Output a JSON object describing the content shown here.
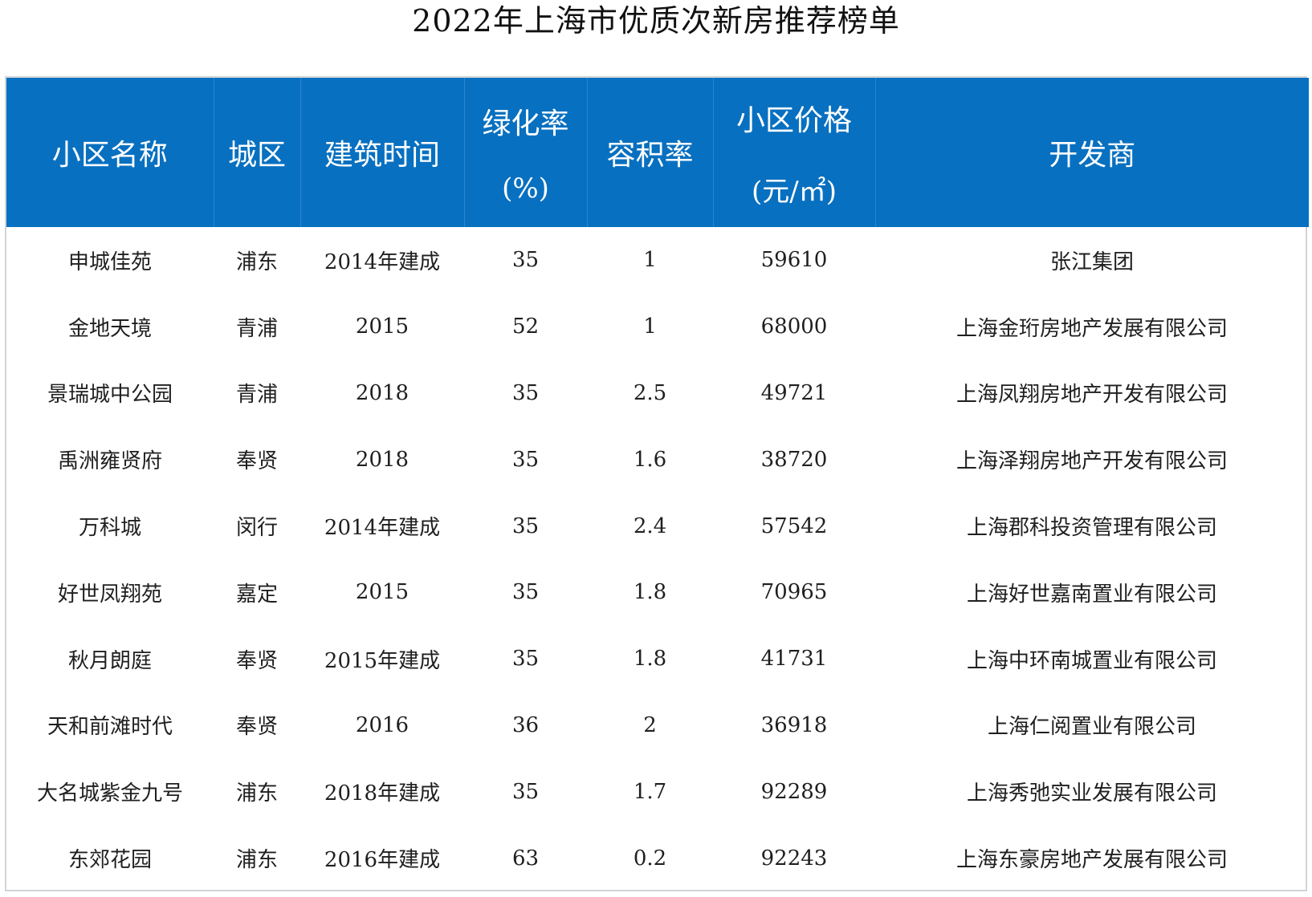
{
  "title": "2022年上海市优质次新房推荐榜单",
  "columns": {
    "name": "小区名称",
    "district": "城区",
    "built": "建筑时间",
    "green_rate": "绿化率",
    "green_rate_unit": "(%)",
    "plot_ratio": "容积率",
    "price": "小区价格",
    "price_unit": "(元/㎡)",
    "developer": "开发商"
  },
  "rows": [
    {
      "name": "申城佳苑",
      "district": "浦东",
      "built": "2014年建成",
      "green_rate": "35",
      "plot_ratio": "1",
      "price": "59610",
      "developer": "张江集团"
    },
    {
      "name": "金地天境",
      "district": "青浦",
      "built": "2015",
      "green_rate": "52",
      "plot_ratio": "1",
      "price": "68000",
      "developer": "上海金珩房地产发展有限公司"
    },
    {
      "name": "景瑞城中公园",
      "district": "青浦",
      "built": "2018",
      "green_rate": "35",
      "plot_ratio": "2.5",
      "price": "49721",
      "developer": "上海凤翔房地产开发有限公司"
    },
    {
      "name": "禹洲雍贤府",
      "district": "奉贤",
      "built": "2018",
      "green_rate": "35",
      "plot_ratio": "1.6",
      "price": "38720",
      "developer": "上海泽翔房地产开发有限公司"
    },
    {
      "name": "万科城",
      "district": "闵行",
      "built": "2014年建成",
      "green_rate": "35",
      "plot_ratio": "2.4",
      "price": "57542",
      "developer": "上海郡科投资管理有限公司"
    },
    {
      "name": "好世凤翔苑",
      "district": "嘉定",
      "built": "2015",
      "green_rate": "35",
      "plot_ratio": "1.8",
      "price": "70965",
      "developer": "上海好世嘉南置业有限公司"
    },
    {
      "name": "秋月朗庭",
      "district": "奉贤",
      "built": "2015年建成",
      "green_rate": "35",
      "plot_ratio": "1.8",
      "price": "41731",
      "developer": "上海中环南城置业有限公司"
    },
    {
      "name": "天和前滩时代",
      "district": "奉贤",
      "built": "2016",
      "green_rate": "36",
      "plot_ratio": "2",
      "price": "36918",
      "developer": "上海仁阅置业有限公司"
    },
    {
      "name": "大名城紫金九号",
      "district": "浦东",
      "built": "2018年建成",
      "green_rate": "35",
      "plot_ratio": "1.7",
      "price": "92289",
      "developer": "上海秀弛实业发展有限公司"
    },
    {
      "name": "东郊花园",
      "district": "浦东",
      "built": "2016年建成",
      "green_rate": "63",
      "plot_ratio": "0.2",
      "price": "92243",
      "developer": "上海东豪房地产发展有限公司"
    }
  ]
}
